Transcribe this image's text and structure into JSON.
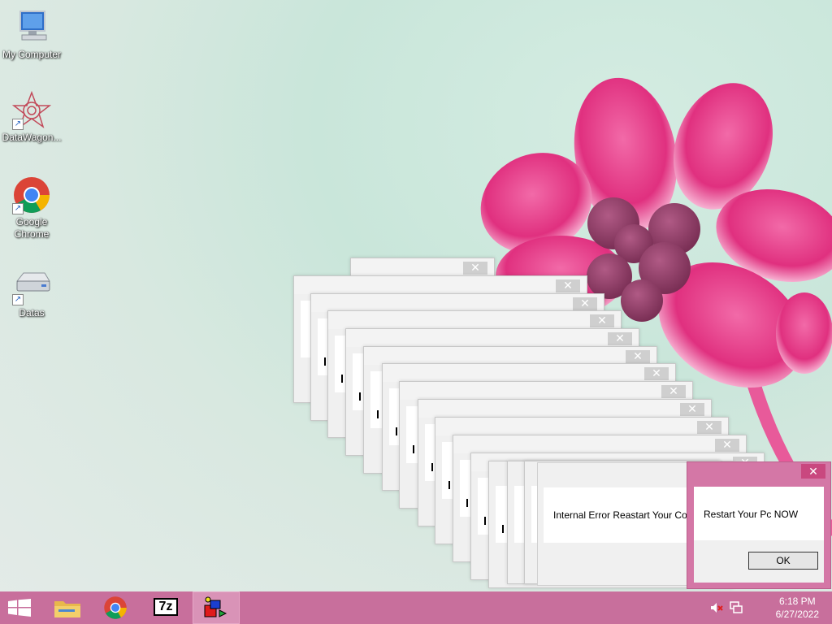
{
  "desktop": {
    "icons": [
      {
        "label": "My Computer",
        "icon": "computer-icon"
      },
      {
        "label": "DataWagon...",
        "icon": "datawagon-icon"
      },
      {
        "label": "Google Chrome",
        "icon": "chrome-icon"
      },
      {
        "label": "Datas",
        "icon": "drive-icon"
      }
    ]
  },
  "dialogs": {
    "close_glyph": "✕",
    "error_message": "Internal Error Reastart Your Com",
    "active": {
      "message": "Restart Your Pc NOW",
      "ok_label": "OK",
      "accent": "#d477a6"
    }
  },
  "taskbar": {
    "color": "#c86f9c",
    "pinned": [
      {
        "name": "start-button",
        "icon": "windows-logo-icon"
      },
      {
        "name": "file-explorer",
        "icon": "folder-icon"
      },
      {
        "name": "chrome",
        "icon": "chrome-icon"
      },
      {
        "name": "7zip",
        "icon": "7zip-icon",
        "text": "7z"
      },
      {
        "name": "running-app",
        "icon": "app-icon"
      }
    ],
    "tray": {
      "volume_icon": "volume-muted-icon",
      "network_icon": "network-icon"
    },
    "clock": {
      "time": "6:18 PM",
      "date": "6/27/2022"
    }
  }
}
